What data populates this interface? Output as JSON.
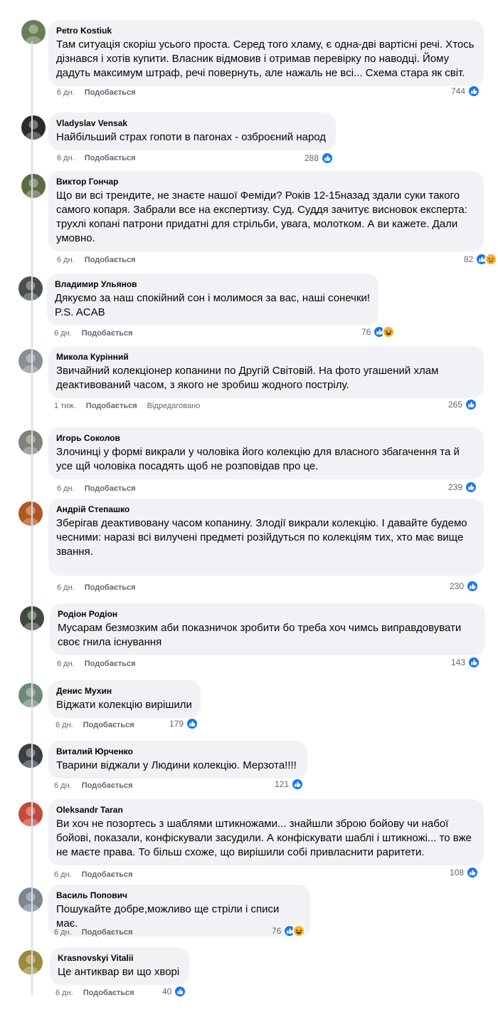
{
  "actions": {
    "like_label": "Подобається",
    "edited_label": "Відредаговано"
  },
  "colors": {
    "like_blue": "#1877f2",
    "emoji_yellow": "#f7b125",
    "bubble_bg": "#f0f2f5",
    "meta_grey": "#65676b"
  },
  "comments": [
    {
      "author": "Petro Kostiuk",
      "text": "Там ситуація скоріш усього проста. Серед того хламу, є одна-дві вартісні речі. Хтось дізнався і хотів купити. Власник відмовив і отримав перевірку по наводці. Йому дадуть максимум штраф, речі повернуть, але нажаль не всі... Схема стара як світ.",
      "time": "6 дн.",
      "reactions": "744",
      "icons": [
        "like-icon"
      ]
    },
    {
      "author": "Vladyslav Vensak",
      "text": "Найбільший страх гопоти в пагонах - озброєний народ",
      "time": "6 дн.",
      "reactions": "288",
      "icons": [
        "like-icon"
      ]
    },
    {
      "author": "Виктор Гончар",
      "text": "Що ви всі трендите, не знаєте нашої Феміди? Років 12-15назад здали суки такого самого копаря. Забрали все на експертизу. Суд. Суддя зачитує висновок експерта: трухлі копані патрони придатні для стрільби, увага, молотком. А ви кажете. Дали умовно.",
      "time": "6 дн.",
      "reactions": "82",
      "icons": [
        "like-icon",
        "sad-icon"
      ]
    },
    {
      "author": "Владимир Ульянов",
      "text": "Дякуємо за наш спокійний сон і молимося за вас, наші сонечки! P.S. ACAB",
      "time": "6 дн.",
      "reactions": "76",
      "icons": [
        "like-icon",
        "haha-icon"
      ]
    },
    {
      "author": "Микола Курінний",
      "text": "Звичайний колекціонер копанини по Другій Світовій. На фото угашений хлам деактивований часом, з якого не зробиш жодного пострілу.",
      "time": "1 тиж.",
      "reactions": "265",
      "icons": [
        "like-icon"
      ],
      "edited": true
    },
    {
      "author": "Игорь Соколов",
      "text": "Злочинці у формі викрали у чоловіка його колекцію для власного збагачення та й усе щй чоловіка посадять щоб не розповідав про це.",
      "time": "6 дн.",
      "reactions": "239",
      "icons": [
        "like-icon"
      ]
    },
    {
      "author": "Андрій Степашко",
      "text": "Зберігав деактивовану часом копанину. Злодії викрали колекцію. І давайте будемо чесними: наразі всі вилучені предметі розійдуться по колекціям тих, хто має вище звання.",
      "time": "6 дн.",
      "reactions": "230",
      "icons": [
        "like-icon"
      ]
    },
    {
      "author": "Родіон Родіон",
      "text": "Мусарам безмозким аби показничок зробити бо треба хоч чимсь виправдовувати своє гнила існування",
      "time": "6 дн.",
      "reactions": "143",
      "icons": [
        "like-icon"
      ]
    },
    {
      "author": "Денис Мухин",
      "text": "Віджати колекцію вирішили",
      "time": "6 дн.",
      "reactions": "179",
      "icons": [
        "like-icon"
      ]
    },
    {
      "author": "Виталий Юрченко",
      "text": "Тварини віджали у Людини колекцію. Мерзота!!!!",
      "time": "6 дн.",
      "reactions": "121",
      "icons": [
        "like-icon"
      ]
    },
    {
      "author": "Oleksandr Taran",
      "text": "Ви хоч не позортесь з шаблями штикножами... знайшли зброю бойову чи набої бойові, показали, конфіскували засудили. А конфіскувати шаблі і штикножі... то вже не маєте права. То більш схоже, що вирішили собі привласнити раритети.",
      "time": "6 дн.",
      "reactions": "108",
      "icons": [
        "like-icon"
      ]
    },
    {
      "author": "Василь Попович",
      "text": "Пошукайте добре,можливо ще стріли і списи має.",
      "time": "6 дн.",
      "reactions": "76",
      "icons": [
        "like-icon",
        "haha-icon"
      ]
    },
    {
      "author": "Krasnovskyi Vitalii",
      "text": "Це антиквар ви що хворі",
      "time": "6 дн.",
      "reactions": "40",
      "icons": [
        "like-icon"
      ]
    }
  ]
}
